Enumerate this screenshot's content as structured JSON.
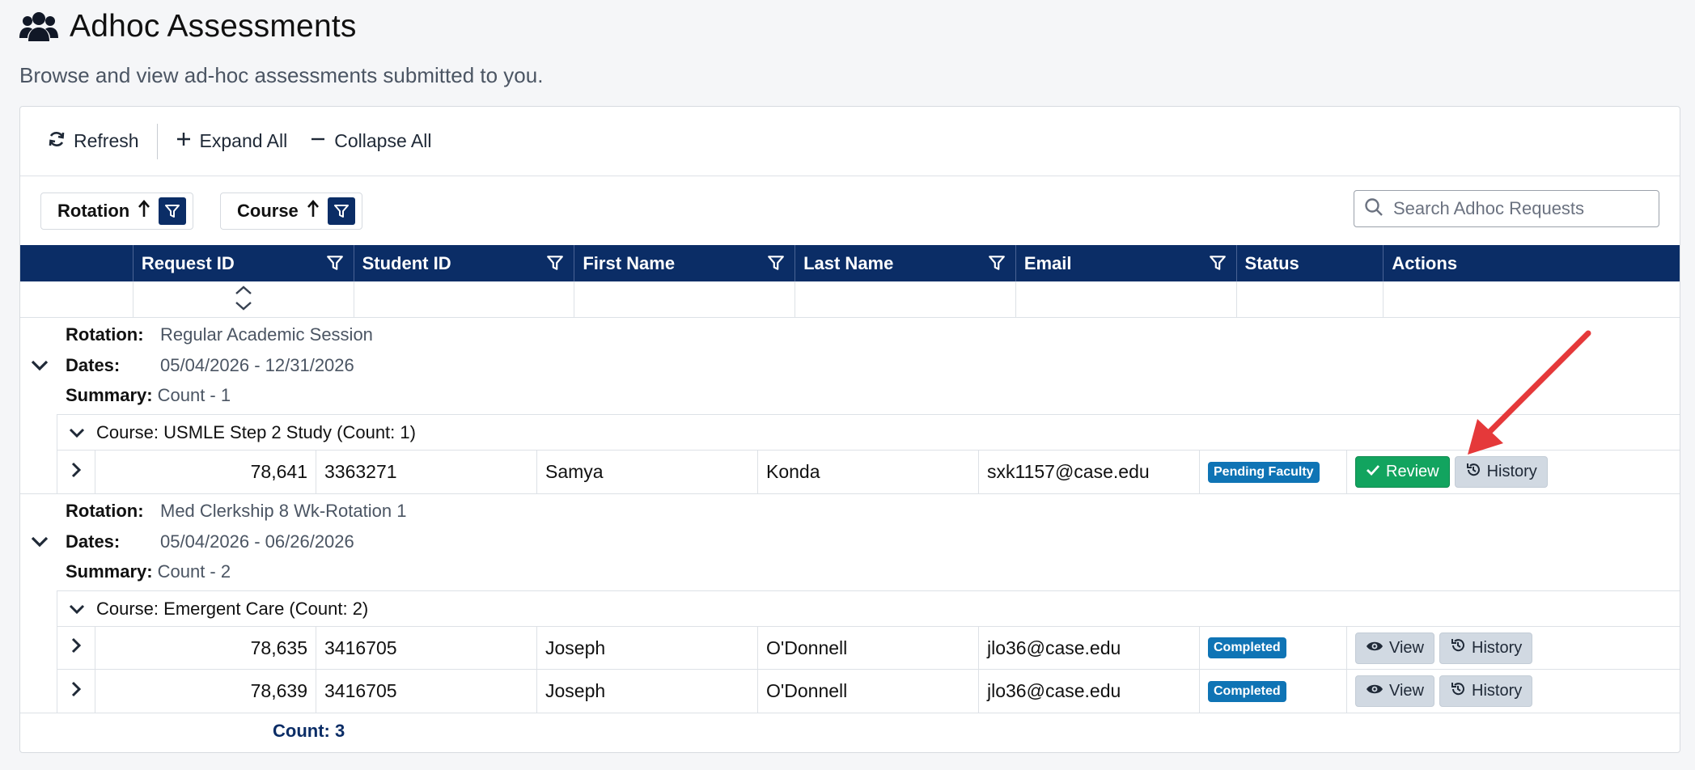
{
  "header": {
    "title": "Adhoc Assessments",
    "subtitle": "Browse and view ad-hoc assessments submitted to you.",
    "icon": "users-icon"
  },
  "toolbar": {
    "refresh_label": "Refresh",
    "expand_label": "Expand All",
    "collapse_label": "Collapse All"
  },
  "grouping": {
    "chips": [
      {
        "label": "Rotation"
      },
      {
        "label": "Course"
      }
    ]
  },
  "search": {
    "placeholder": "Search Adhoc Requests"
  },
  "columns": [
    "Request ID",
    "Student ID",
    "First Name",
    "Last Name",
    "Email",
    "Status",
    "Actions"
  ],
  "groups": [
    {
      "rotation_label": "Rotation:",
      "rotation": "Regular Academic Session",
      "dates_label": "Dates:",
      "dates": "05/04/2026 - 12/31/2026",
      "summary_label": "Summary:",
      "summary": "Count - 1",
      "courses": [
        {
          "title": "Course: USMLE Step 2 Study (Count: 1)",
          "rows": [
            {
              "request_id": "78,641",
              "student_id": "3363271",
              "first": "Samya",
              "last": "Konda",
              "email": "sxk1157@case.edu",
              "status": "Pending Faculty",
              "primary_action": "Review",
              "secondary_action": "History"
            }
          ]
        }
      ]
    },
    {
      "rotation_label": "Rotation:",
      "rotation": "Med Clerkship 8 Wk-Rotation 1",
      "dates_label": "Dates:",
      "dates": "05/04/2026 - 06/26/2026",
      "summary_label": "Summary:",
      "summary": "Count - 2",
      "courses": [
        {
          "title": "Course: Emergent Care (Count: 2)",
          "rows": [
            {
              "request_id": "78,635",
              "student_id": "3416705",
              "first": "Joseph",
              "last": "O'Donnell",
              "email": "jlo36@case.edu",
              "status": "Completed",
              "primary_action": "View",
              "secondary_action": "History"
            },
            {
              "request_id": "78,639",
              "student_id": "3416705",
              "first": "Joseph",
              "last": "O'Donnell",
              "email": "jlo36@case.edu",
              "status": "Completed",
              "primary_action": "View",
              "secondary_action": "History"
            }
          ]
        }
      ]
    }
  ],
  "footer": {
    "count": "Count: 3"
  },
  "colors": {
    "header_bg": "#0b2d66",
    "review_green": "#12a45f",
    "badge_blue": "#0f74b5",
    "annotation_arrow": "#e5393a"
  }
}
